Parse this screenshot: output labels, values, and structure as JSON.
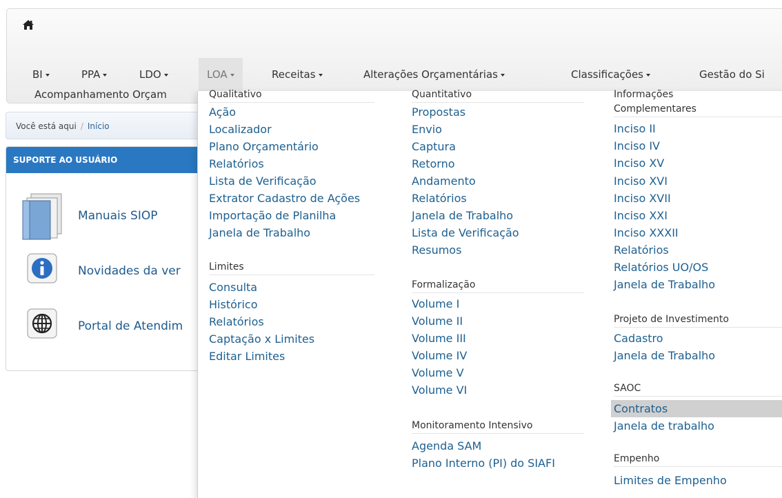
{
  "nav": {
    "items": [
      {
        "label": "BI"
      },
      {
        "label": "PPA"
      },
      {
        "label": "LDO"
      },
      {
        "label": "LOA"
      },
      {
        "label": "Receitas"
      },
      {
        "label": "Alterações Orçamentárias"
      },
      {
        "label": "Classificações"
      },
      {
        "label": "Gestão do Si"
      }
    ],
    "row2_label": "Acompanhamento Orçam",
    "active": "LOA"
  },
  "breadcrumb": {
    "prefix": "Você está aqui",
    "home": "Início"
  },
  "support": {
    "title": "SUPORTE AO USUÁRIO",
    "items": [
      {
        "label": "Manuais SIOP",
        "icon": "books-icon"
      },
      {
        "label": "Novidades da ver",
        "icon": "info-icon"
      },
      {
        "label": "Portal de Atendim",
        "icon": "globe-icon"
      }
    ]
  },
  "menu": {
    "col1": {
      "qualitativo": {
        "title": "Qualitativo",
        "items": [
          "Ação",
          "Localizador",
          "Plano Orçamentário",
          "Relatórios",
          "Lista de Verificação",
          "Extrator Cadastro de Ações",
          "Importação de Planilha",
          "Janela de Trabalho"
        ]
      },
      "limites": {
        "title": "Limites",
        "items": [
          "Consulta",
          "Histórico",
          "Relatórios",
          "Captação x Limites",
          "Editar Limites"
        ]
      }
    },
    "col2": {
      "quantitativo": {
        "title": "Quantitativo",
        "items": [
          "Propostas",
          "Envio",
          "Captura",
          "Retorno",
          "Andamento",
          "Relatórios",
          "Janela de Trabalho",
          "Lista de Verificação",
          "Resumos"
        ]
      },
      "formalizacao": {
        "title": "Formalização",
        "items": [
          "Volume I",
          "Volume II",
          "Volume III",
          "Volume IV",
          "Volume V",
          "Volume VI"
        ]
      },
      "monitoramento": {
        "title": "Monitoramento Intensivo",
        "items": [
          "Agenda SAM",
          "Plano Interno (PI) do SIAFI"
        ]
      }
    },
    "col3": {
      "info": {
        "title_line1": "Informações",
        "title_line2": "Complementares",
        "items": [
          "Inciso II",
          "Inciso IV",
          "Inciso XV",
          "Inciso XVI",
          "Inciso XVII",
          "Inciso XXI",
          "Inciso XXXII",
          "Relatórios",
          "Relatórios UO/OS",
          "Janela de Trabalho"
        ]
      },
      "projeto": {
        "title": "Projeto de Investimento",
        "items": [
          "Cadastro",
          "Janela de Trabalho"
        ]
      },
      "saoc": {
        "title": "SAOC",
        "items": [
          "Contratos",
          "Janela de trabalho"
        ],
        "highlighted": "Contratos"
      },
      "empenho": {
        "title": "Empenho",
        "items": [
          "Limites de Empenho"
        ]
      }
    }
  }
}
